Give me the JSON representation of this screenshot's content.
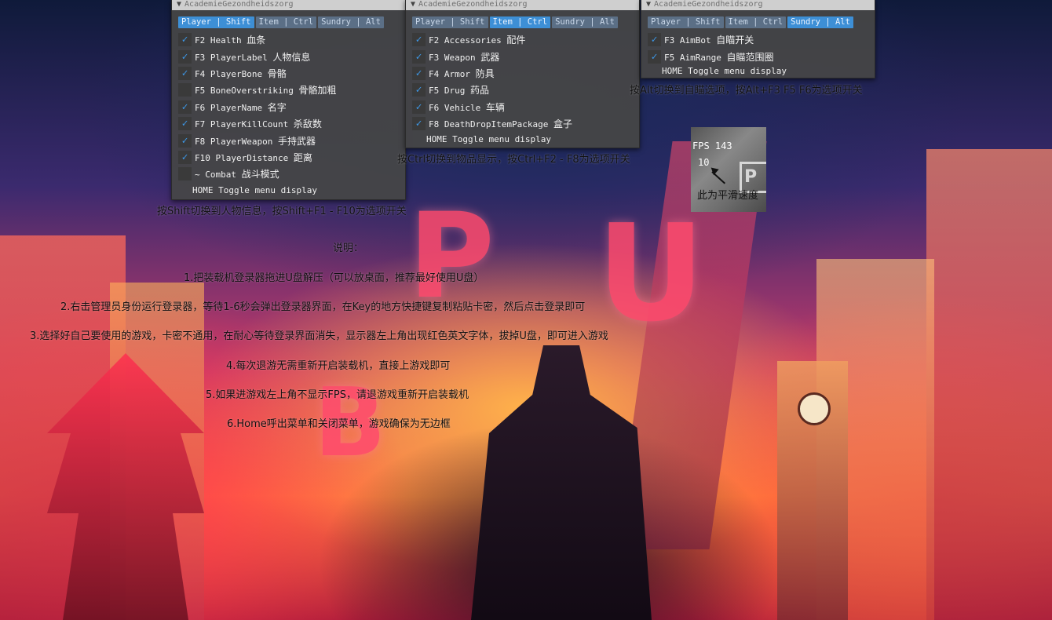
{
  "window_title": "AcademieGezondheidszorg",
  "tabs": [
    "Player | Shift",
    "Item | Ctrl",
    "Sundry | Alt"
  ],
  "player_menu": {
    "active_tab": 0,
    "items": [
      {
        "checked": true,
        "key": "F2 Health",
        "cn": "血条"
      },
      {
        "checked": true,
        "key": "F3 PlayerLabel",
        "cn": "人物信息"
      },
      {
        "checked": true,
        "key": "F4 PlayerBone",
        "cn": "骨骼"
      },
      {
        "checked": false,
        "key": "F5 BoneOverstriking",
        "cn": "骨骼加粗"
      },
      {
        "checked": true,
        "key": "F6 PlayerName",
        "cn": "名字"
      },
      {
        "checked": true,
        "key": "F7 PlayerKillCount",
        "cn": "杀敌数"
      },
      {
        "checked": true,
        "key": "F8 PlayerWeapon",
        "cn": "手持武器"
      },
      {
        "checked": true,
        "key": "F10 PlayerDistance",
        "cn": "距离"
      },
      {
        "checked": false,
        "key": "~  Combat",
        "cn": "战斗模式"
      }
    ],
    "footer": "HOME Toggle menu display"
  },
  "item_menu": {
    "active_tab": 1,
    "items": [
      {
        "checked": true,
        "key": "F2 Accessories",
        "cn": "配件"
      },
      {
        "checked": true,
        "key": "F3 Weapon",
        "cn": "武器"
      },
      {
        "checked": true,
        "key": "F4 Armor",
        "cn": "防具"
      },
      {
        "checked": true,
        "key": "F5 Drug",
        "cn": "药品"
      },
      {
        "checked": true,
        "key": "F6 Vehicle",
        "cn": "车辆"
      },
      {
        "checked": true,
        "key": "F8 DeathDropItemPackage",
        "cn": "盒子"
      }
    ],
    "footer": "HOME Toggle menu display"
  },
  "sundry_menu": {
    "active_tab": 2,
    "items": [
      {
        "checked": true,
        "key": "F3 AimBot",
        "cn": "自瞄开关"
      },
      {
        "checked": true,
        "key": "F5 AimRange",
        "cn": "自瞄范围圈"
      }
    ],
    "footer": "HOME Toggle menu display"
  },
  "captions": {
    "player": "按Shift切换到人物信息，按Shift+F1 - F10为选项开关",
    "item": "按Ctrl切换到物品显示，按Ctrl+F2 - F8为选项开关",
    "sundry": "按Alt切换到自瞄选项，按Alt+F3 F5 F6为选项开关"
  },
  "fps_overlay": {
    "fps_label": "FPS 143",
    "value": "10",
    "note": "此为平滑速度",
    "logo": "P"
  },
  "instructions": {
    "heading": "说明：",
    "lines": [
      "1.把装载机登录器拖进U盘解压（可以放桌面，推荐最好使用U盘）",
      "2.右击管理员身份运行登录器，等待1-6秒会弹出登录器界面，在Key的地方快捷键复制粘贴卡密，然后点击登录即可",
      "3.选择好自己要使用的游戏，卡密不通用，在耐心等待登录界面消失，显示器左上角出现红色英文字体，拔掉U盘，即可进入游戏",
      "4.每次退游无需重新开启装载机，直接上游戏即可",
      "5.如果进游戏左上角不显示FPS，请退游戏重新开启装载机",
      "6.Home呼出菜单和关闭菜单，游戏确保为无边框"
    ]
  },
  "colors": {
    "menu_bg": "#464646",
    "tab_active": "#3d8fd6",
    "tab_inactive": "#5b6f86",
    "check": "#3d97e6"
  }
}
